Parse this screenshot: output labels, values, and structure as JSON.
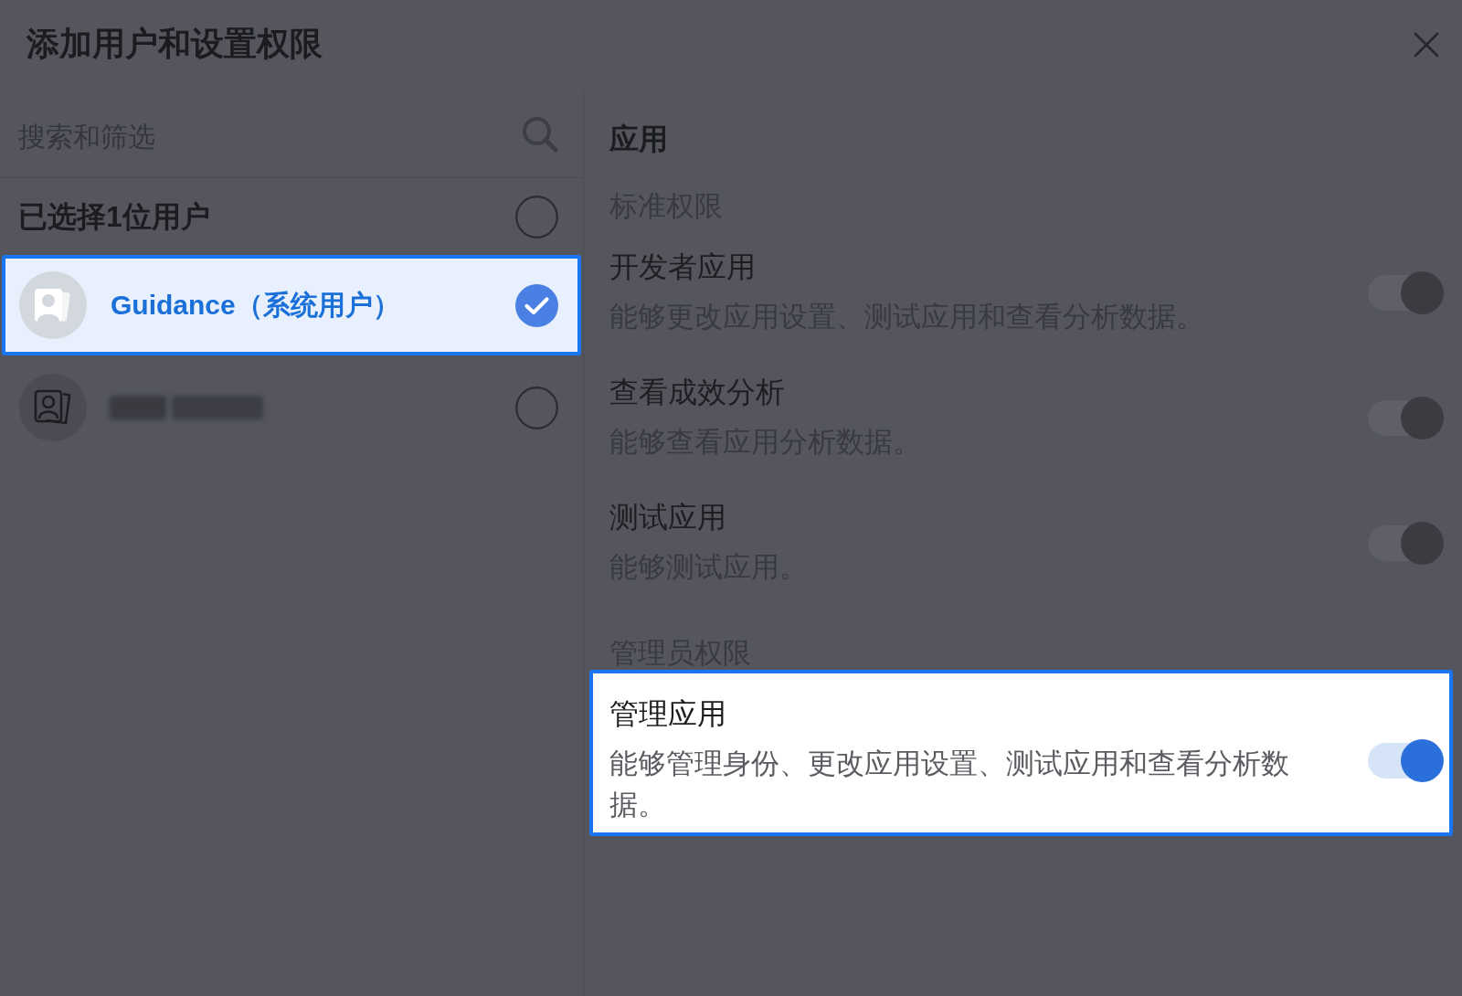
{
  "dialog": {
    "title": "添加用户和设置权限"
  },
  "search": {
    "placeholder": "搜索和筛选"
  },
  "selection": {
    "label": "已选择1位用户",
    "checked": false
  },
  "users": [
    {
      "kind": "named",
      "name": "Guidance（系统用户）",
      "selected": true,
      "highlighted": true
    },
    {
      "kind": "redacted",
      "selected": false,
      "highlighted": false
    }
  ],
  "permissions": {
    "title": "应用",
    "groups": [
      {
        "heading": "标准权限",
        "items": [
          {
            "name": "开发者应用",
            "description": "能够更改应用设置、测试应用和查看分析数据。",
            "on": true,
            "disabled": true,
            "highlighted": false
          },
          {
            "name": "查看成效分析",
            "description": "能够查看应用分析数据。",
            "on": true,
            "disabled": true,
            "highlighted": false
          },
          {
            "name": "测试应用",
            "description": "能够测试应用。",
            "on": true,
            "disabled": true,
            "highlighted": false
          }
        ]
      },
      {
        "heading": "管理员权限",
        "items": [
          {
            "name": "管理应用",
            "description": "能够管理身份、更改应用设置、测试应用和查看分析数据。",
            "on": true,
            "disabled": false,
            "highlighted": true
          }
        ]
      }
    ]
  }
}
